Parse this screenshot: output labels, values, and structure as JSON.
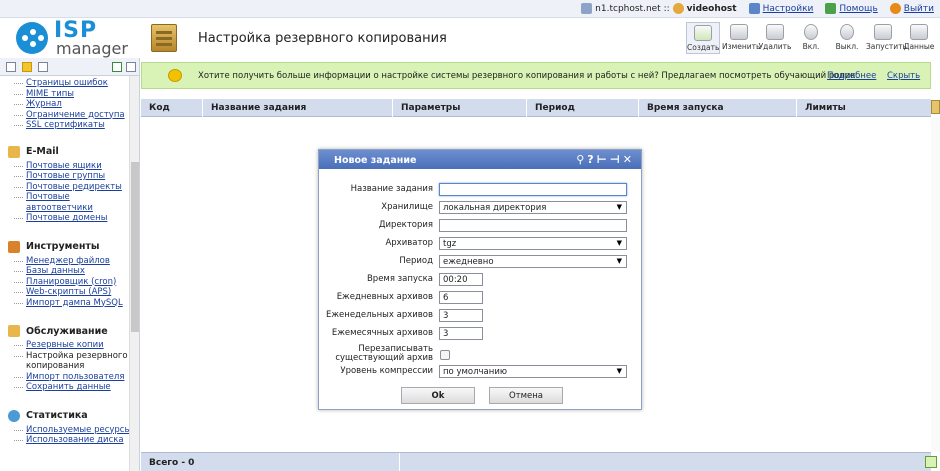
{
  "topbar": {
    "host": "n1.tcphost.net ::",
    "user": "videohost",
    "settings": "Настройки",
    "help": "Помощь",
    "logout": "Выйти"
  },
  "logo": {
    "isp": "ISP",
    "manager": "manager"
  },
  "page_title": "Настройка резервного копирования",
  "toolbar": [
    {
      "label": "Создать",
      "icon": "create-icon"
    },
    {
      "label": "Изменить",
      "icon": "edit-icon"
    },
    {
      "label": "Удалить",
      "icon": "delete-icon"
    },
    {
      "label": "Вкл.",
      "icon": "bulb-on-icon"
    },
    {
      "label": "Выкл.",
      "icon": "bulb-off-icon"
    },
    {
      "label": "Запустить",
      "icon": "play-icon"
    },
    {
      "label": "Данные",
      "icon": "data-icon"
    }
  ],
  "sidebar": {
    "top_links": [
      "Страницы ошибок",
      "MIME типы",
      "Журнал",
      "Ограничение доступа",
      "SSL сертификаты"
    ],
    "groups": [
      {
        "title": "E-Mail",
        "items": [
          "Почтовые ящики",
          "Почтовые группы",
          "Почтовые редиректы",
          "Почтовые автоответчики",
          "Почтовые домены"
        ]
      },
      {
        "title": "Инструменты",
        "items": [
          "Менеджер файлов",
          "Базы данных",
          "Планировщик (cron)",
          "Web-скрипты (APS)",
          "Импорт дампа MySQL"
        ]
      },
      {
        "title": "Обслуживание",
        "items": [
          "Резервные копии",
          "Настройка резервного копирования",
          "Импорт пользователя",
          "Сохранить данные"
        ]
      },
      {
        "title": "Статистика",
        "items": [
          "Используемые ресурсы",
          "Использование диска"
        ]
      }
    ]
  },
  "banner": {
    "text": "Хотите получить больше информации о настройке системы резервного копирования и работы с ней? Предлагаем посмотреть обучающий ролик.",
    "more": "Подробнее",
    "hide": "Скрыть"
  },
  "table": {
    "columns": [
      "Код",
      "Название задания",
      "Параметры",
      "Период",
      "Время запуска",
      "Лимиты"
    ],
    "total": "Всего - 0"
  },
  "dialog": {
    "title": "Новое задание",
    "fields": {
      "name_label": "Название задания",
      "name_value": "",
      "storage_label": "Хранилище",
      "storage_value": "локальная директория",
      "dir_label": "Директория",
      "dir_value": "",
      "archiver_label": "Архиватор",
      "archiver_value": "tgz",
      "period_label": "Период",
      "period_value": "ежедневно",
      "time_label": "Время запуска",
      "time_value": "00:20",
      "daily_label": "Ежедневных архивов",
      "daily_value": "6",
      "weekly_label": "Еженедельных архивов",
      "weekly_value": "3",
      "monthly_label": "Ежемесячных архивов",
      "monthly_value": "3",
      "overwrite_label_1": "Перезаписывать",
      "overwrite_label_2": "существующий архив",
      "compression_label": "Уровень компрессии",
      "compression_value": "по умолчанию"
    },
    "ok": "Ok",
    "cancel": "Отмена"
  }
}
